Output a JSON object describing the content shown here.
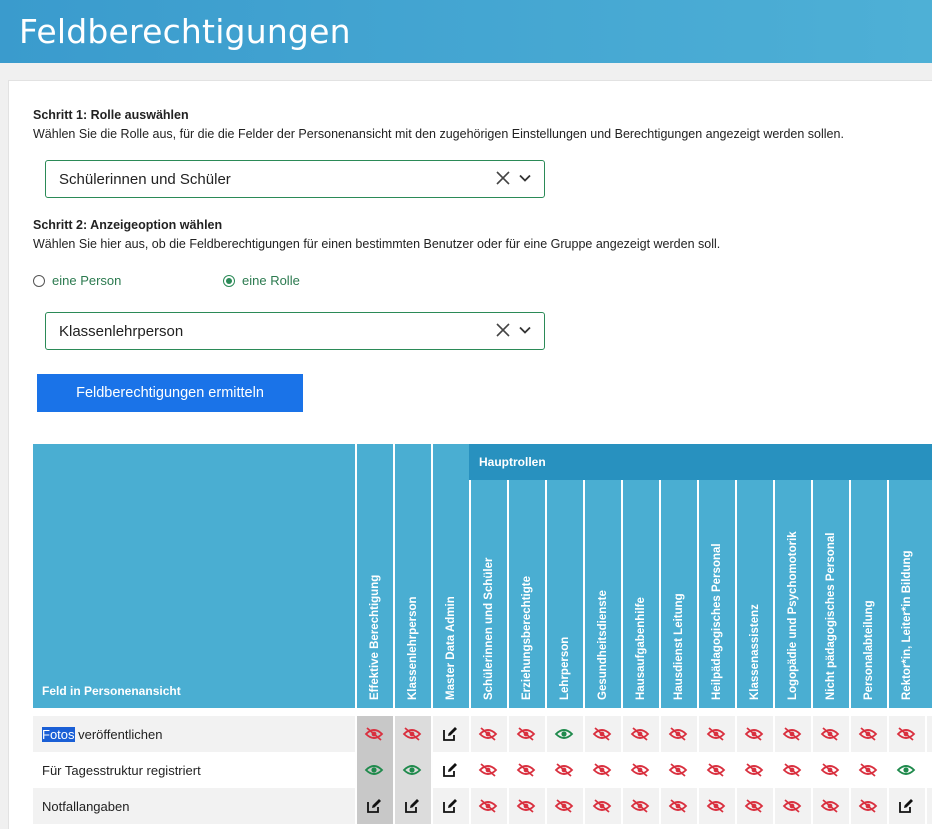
{
  "page": {
    "title": "Feldberechtigungen"
  },
  "step1": {
    "title": "Schritt 1: Rolle auswählen",
    "description": "Wählen Sie die Rolle aus, für die die Felder der Personenansicht mit den zugehörigen Einstellungen und Berechtigungen angezeigt werden sollen.",
    "selected_value": "Schülerinnen und Schüler"
  },
  "step2": {
    "title": "Schritt 2: Anzeigeoption wählen",
    "description": "Wählen Sie hier aus, ob die Feldberechtigungen für einen bestimmten Benutzer oder für eine Gruppe angezeigt werden soll.",
    "options": [
      {
        "label": "eine Person",
        "selected": false
      },
      {
        "label": "eine Rolle",
        "selected": true
      }
    ],
    "selected_value": "Klassenlehrperson"
  },
  "submit_button": {
    "label": "Feldberechtigungen ermitteln"
  },
  "table": {
    "corner_label": "Feld in Personenansicht",
    "group_label": "Hauptrollen",
    "columns": [
      "Effektive Berechtigung",
      "Klassenlehrperson",
      "Master Data Admin",
      "Schülerinnen und Schüler",
      "Erziehungsberechtigte",
      "Lehrperson",
      "Gesundheitsdienste",
      "Hausaufgabenhilfe",
      "Hausdienst Leitung",
      "Heilpädagogisches Personal",
      "Klassenassistenz",
      "Logopädie und Psychomotorik",
      "Nicht pädagogisches Personal",
      "Personalabteilung",
      "Rektor*in, Leiter*in Bildung"
    ],
    "rows": [
      {
        "label_highlight": "Fotos",
        "label_rest": " veröffentlichen",
        "cells": [
          "hidden",
          "hidden",
          "edit",
          "hidden",
          "hidden",
          "view",
          "hidden",
          "hidden",
          "hidden",
          "hidden",
          "hidden",
          "hidden",
          "hidden",
          "hidden",
          "hidden"
        ]
      },
      {
        "label_highlight": "",
        "label_rest": "Für Tagesstruktur registriert",
        "cells": [
          "view",
          "view",
          "edit",
          "hidden",
          "hidden",
          "hidden",
          "hidden",
          "hidden",
          "hidden",
          "hidden",
          "hidden",
          "hidden",
          "hidden",
          "hidden",
          "view"
        ]
      },
      {
        "label_highlight": "",
        "label_rest": "Notfallangaben",
        "cells": [
          "edit",
          "edit",
          "edit",
          "hidden",
          "hidden",
          "hidden",
          "hidden",
          "hidden",
          "hidden",
          "hidden",
          "hidden",
          "hidden",
          "hidden",
          "hidden",
          "edit"
        ]
      }
    ]
  },
  "colors": {
    "header_bg": "#3a9bcd",
    "table_header_bg": "#4aaed2",
    "group_header_bg": "#2891bf",
    "accent_green": "#2b8a57",
    "button_blue": "#1a73e8",
    "hidden_icon": "#d9303f",
    "view_icon": "#1f8a4c",
    "edit_icon": "#111111"
  },
  "icons": {
    "hidden": "eye-off-icon",
    "view": "eye-icon",
    "edit": "edit-icon",
    "clear": "close-icon",
    "dropdown": "chevron-down-icon"
  }
}
